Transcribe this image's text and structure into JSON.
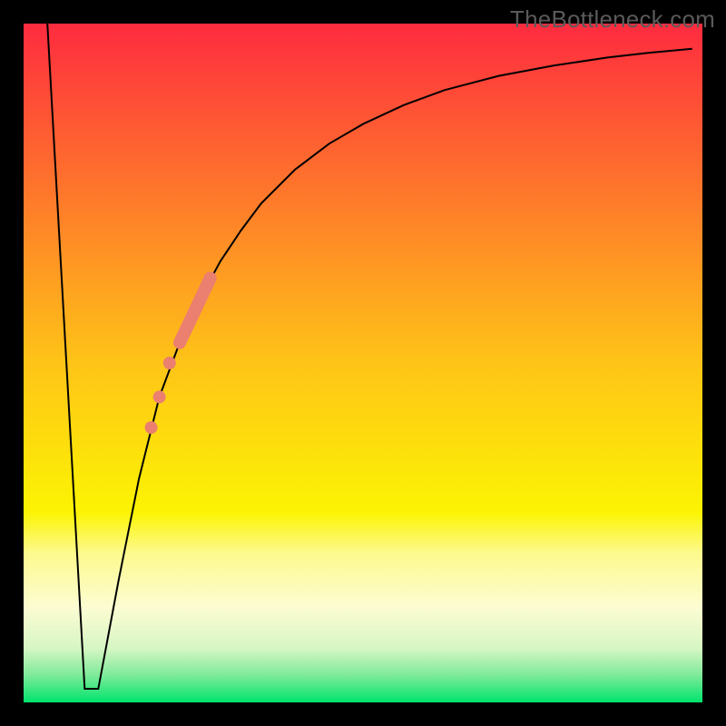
{
  "chart_data": {
    "type": "line",
    "title": "",
    "xlabel": "",
    "ylabel": "",
    "xlim": [
      0,
      100
    ],
    "ylim": [
      0,
      100
    ],
    "grid": false,
    "legend": false,
    "background": {
      "type": "vertical-gradient",
      "stops": [
        {
          "pos": 0.0,
          "color": "#fe2b3f"
        },
        {
          "pos": 0.5,
          "color": "#fec417"
        },
        {
          "pos": 0.72,
          "color": "#fcf403"
        },
        {
          "pos": 0.78,
          "color": "#fdfa8e"
        },
        {
          "pos": 0.86,
          "color": "#fcfcd2"
        },
        {
          "pos": 0.92,
          "color": "#d7f6c4"
        },
        {
          "pos": 0.96,
          "color": "#7eea9a"
        },
        {
          "pos": 1.0,
          "color": "#00e46c"
        }
      ]
    },
    "series": [
      {
        "name": "bottleneck-curve",
        "color": "#000000",
        "width": 2,
        "x": [
          3.5,
          9.0,
          11.0,
          14.0,
          17.0,
          20.0,
          23.0,
          26.0,
          29.0,
          32.0,
          35.0,
          40.0,
          45.0,
          50.0,
          56.0,
          62.0,
          70.0,
          78.0,
          86.0,
          92.0,
          98.5
        ],
        "y": [
          100.0,
          2.0,
          2.0,
          18.0,
          33.0,
          45.0,
          53.0,
          59.5,
          65.0,
          69.5,
          73.5,
          78.5,
          82.3,
          85.2,
          88.0,
          90.2,
          92.3,
          93.8,
          95.0,
          95.7,
          96.3
        ]
      }
    ],
    "highlights": [
      {
        "name": "thick-segment",
        "color": "#eb7f70",
        "width": 14,
        "x": [
          23.0,
          27.5
        ],
        "y": [
          53.0,
          62.5
        ]
      }
    ],
    "points": [
      {
        "x": 21.5,
        "y": 50.0,
        "r": 7,
        "color": "#eb7f70"
      },
      {
        "x": 20.0,
        "y": 45.0,
        "r": 7,
        "color": "#eb7f70"
      },
      {
        "x": 18.8,
        "y": 40.5,
        "r": 7,
        "color": "#eb7f70"
      }
    ],
    "frame": {
      "border_color": "#000000",
      "border_width": 26
    }
  },
  "watermark": {
    "text": "TheBottleneck.com"
  }
}
